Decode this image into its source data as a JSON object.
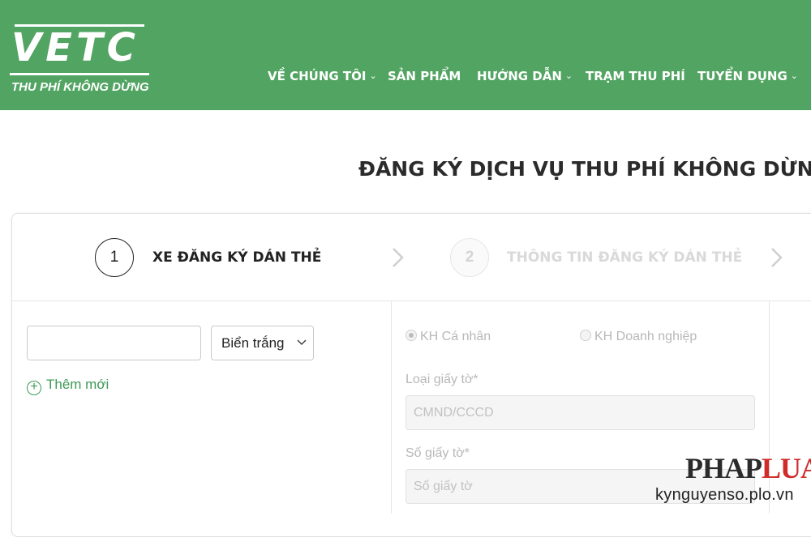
{
  "colors": {
    "brand_green": "#52a462",
    "link_green": "#3d9a55"
  },
  "brand": {
    "logo_text": "VETC",
    "tagline": "THU PHÍ KHÔNG DỪNG"
  },
  "nav": {
    "items": [
      {
        "label": "VỀ CHÚNG TÔI",
        "has_dropdown": true
      },
      {
        "label": "SẢN PHẨM",
        "has_dropdown": false
      },
      {
        "label": "HƯỚNG DẪN",
        "has_dropdown": true
      },
      {
        "label": "TRẠM THU PHÍ",
        "has_dropdown": false
      },
      {
        "label": "TUYỂN DỤNG",
        "has_dropdown": true
      }
    ],
    "dropdown_glyph": "⌄"
  },
  "page": {
    "title": "ĐĂNG KÝ DỊCH VỤ THU PHÍ KHÔNG DỪNG"
  },
  "steps": [
    {
      "number": "1",
      "label": "XE ĐĂNG KÝ DÁN THẺ",
      "active": true
    },
    {
      "number": "2",
      "label": "THÔNG TIN ĐĂNG KÝ DÁN THẺ",
      "active": false
    }
  ],
  "vehicle": {
    "plate_input": {
      "value": "",
      "placeholder": ""
    },
    "plate_type": {
      "selected": "Biển trắng"
    },
    "add_new_label": "Thêm mới",
    "add_icon": "plus-circle-icon"
  },
  "customer": {
    "types": [
      {
        "label": "KH Cá nhân",
        "checked": true
      },
      {
        "label": "KH Doanh nghiệp",
        "checked": false
      }
    ],
    "id_type": {
      "label": "Loại giấy tờ*",
      "value": "CMND/CCCD"
    },
    "id_number": {
      "label": "Số giấy tờ*",
      "placeholder": "Số giấy tờ"
    }
  },
  "watermark": {
    "logo_part1": "PHAP",
    "logo_part2": "LUAT",
    "url": "kynguyenso.plo.vn"
  }
}
